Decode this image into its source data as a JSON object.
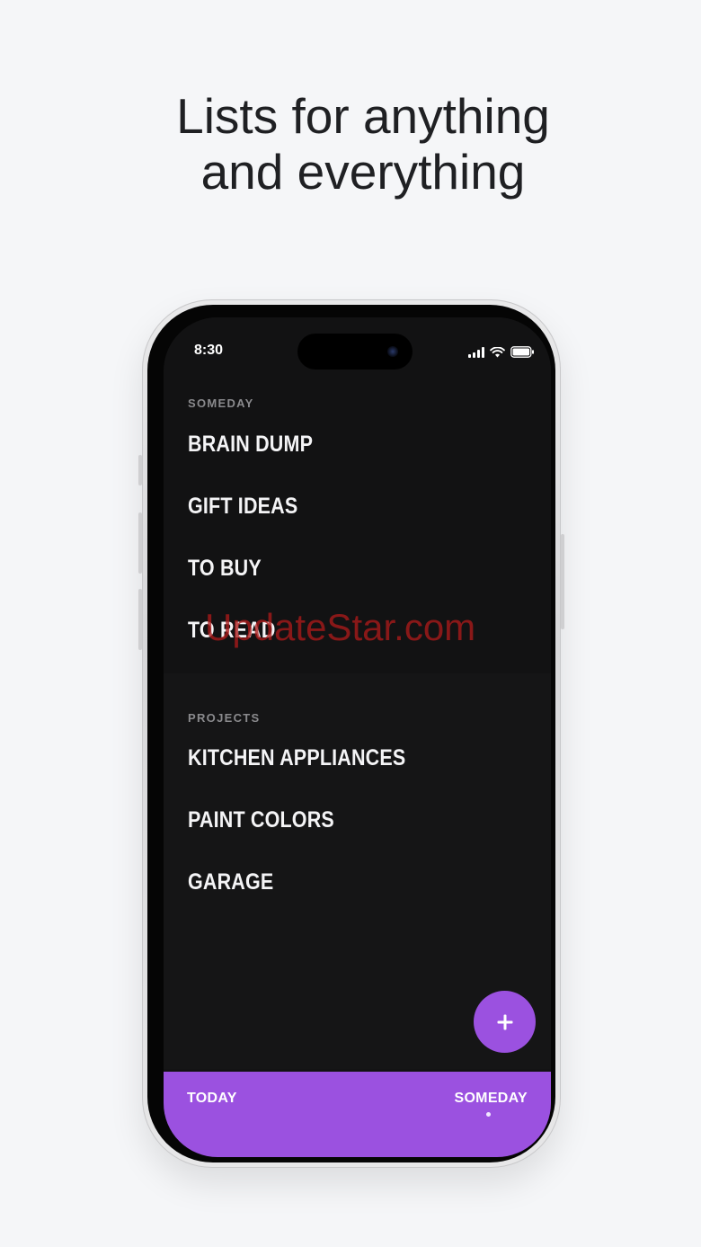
{
  "headline": {
    "line1": "Lists for anything",
    "line2": "and everything"
  },
  "status_bar": {
    "time": "8:30",
    "signal_icon": "cellular-signal-icon",
    "wifi_icon": "wifi-icon",
    "battery_icon": "battery-icon"
  },
  "sections": {
    "someday": {
      "label": "SOMEDAY",
      "items": [
        "BRAIN DUMP",
        "GIFT IDEAS",
        "TO BUY",
        "TO READ"
      ]
    },
    "projects": {
      "label": "PROJECTS",
      "items": [
        "KITCHEN APPLIANCES",
        "PAINT COLORS",
        "GARAGE"
      ]
    }
  },
  "fab": {
    "icon": "plus-icon",
    "label": "+"
  },
  "bottom_nav": {
    "tabs": [
      {
        "label": "TODAY",
        "active": false
      },
      {
        "label": "SOMEDAY",
        "active": true
      }
    ]
  },
  "watermark": "UpdateStar.com",
  "colors": {
    "background": "#f5f6f8",
    "screen": "#131314",
    "accent": "#9b51e0",
    "section_label": "#8a8a8d",
    "item_text": "#f4f4f6"
  }
}
